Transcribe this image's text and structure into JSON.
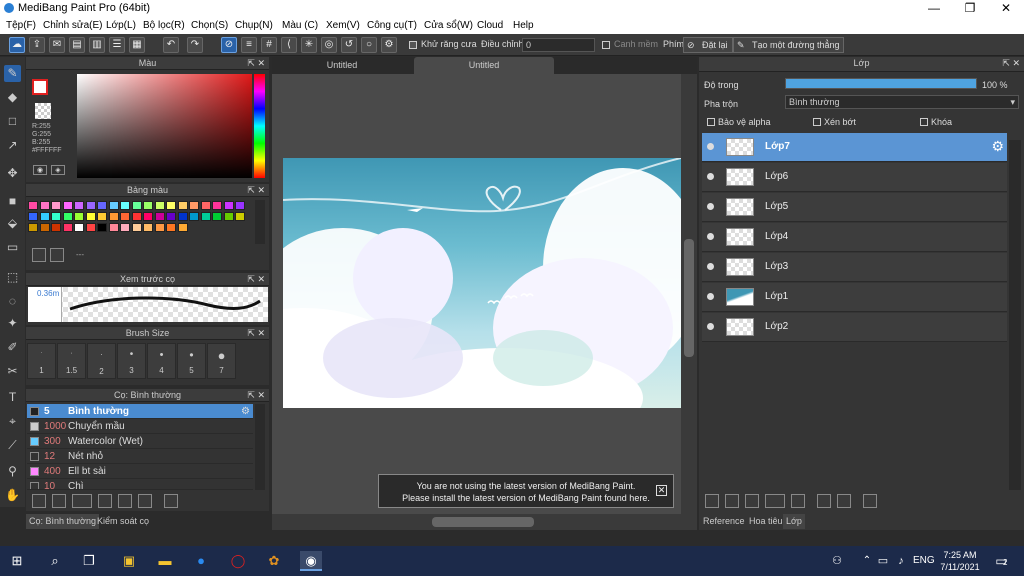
{
  "titlebar": {
    "title": "MediBang Paint Pro (64bit)",
    "minimize": "—",
    "maximize": "❐",
    "close": "✕"
  },
  "menu": [
    "Tệp(F)",
    "Chỉnh sửa(E)",
    "Lớp(L)",
    "Bộ lọc(R)",
    "Chọn(S)",
    "Chụp(N)",
    "Màu (C)",
    "Xem(V)",
    "Công cụ(T)",
    "Cửa sổ(W)",
    "Cloud",
    "Help"
  ],
  "toolbar": {
    "antialias_label": "Khử răng cưa",
    "correction_label": "Điều chỉnh",
    "correction_value": "0",
    "snap_label": "Canh mềm",
    "shortcut_label": "Phím",
    "reset_label": "Đặt lại",
    "straight_line_label": "Tạo một đường thẳng"
  },
  "color_panel": {
    "title": "Màu",
    "r": "R:255",
    "g": "G:255",
    "b": "B:255",
    "hex": "#FFFFFF"
  },
  "palette_panel": {
    "title": "Bảng màu",
    "dash": "---",
    "swatches": [
      "#ff4aa3",
      "#ff73c6",
      "#ff99cc",
      "#ff66ff",
      "#cc66ff",
      "#9966ff",
      "#6666ff",
      "#66ccff",
      "#66ffff",
      "#66ff99",
      "#99ff66",
      "#ccff66",
      "#ffff66",
      "#ffcc66",
      "#ff9966",
      "#ff6666",
      "#ff3399",
      "#cc33ff",
      "#9933ff",
      "#3366ff",
      "#33ccff",
      "#33ffcc",
      "#33ff66",
      "#99ff33",
      "#ffff33",
      "#ffcc33",
      "#ff9933",
      "#ff6633",
      "#ff3333",
      "#ff0066",
      "#cc0099",
      "#6600cc",
      "#0033cc",
      "#0099cc",
      "#00cc99",
      "#00cc33",
      "#66cc00",
      "#cccc00",
      "#cc9900",
      "#cc6600",
      "#cc3300",
      "#ff3366",
      "#ffffff",
      "#ff4444",
      "#000000",
      "#ff8899",
      "#ffaabb",
      "#ffcc99",
      "#ffbb66",
      "#ff9944",
      "#ff7722",
      "#ffaa33"
    ]
  },
  "preview_panel": {
    "title": "Xem trước cọ",
    "size": "0.36m"
  },
  "brushsize_panel": {
    "title": "Brush Size",
    "sizes": [
      "1",
      "1.5",
      "2",
      "3",
      "4",
      "5",
      "7"
    ]
  },
  "brush_panel": {
    "title": "Cọ: Bình thường",
    "brushes": [
      {
        "size": "5",
        "name": "Bình thường",
        "color": "#222222"
      },
      {
        "size": "1000",
        "name": "Chuyển mầu",
        "color": "#cccccc"
      },
      {
        "size": "300",
        "name": "Watercolor (Wet)",
        "color": "#66ccff"
      },
      {
        "size": "12",
        "name": "Nét nhỏ",
        "color": "#333333"
      },
      {
        "size": "400",
        "name": "Ell bt sài",
        "color": "#ff88ff"
      },
      {
        "size": "10",
        "name": "Chì",
        "color": "#333333"
      }
    ]
  },
  "left_bottom_tabs": [
    "Cọ: Bình thường",
    "Kiểm soát cọ"
  ],
  "doc_tabs": [
    "Untitled",
    "Untitled"
  ],
  "notification": {
    "line1": "You are not using the latest version of MediBang Paint.",
    "line2": "Please install the latest version of MediBang Paint found here.",
    "close": "✕"
  },
  "layer_panel": {
    "title": "Lớp",
    "opacity_label": "Độ trong",
    "opacity_value": "100 %",
    "opacity_fraction": 1.0,
    "blend_label": "Pha trộn",
    "blend_value": "Bình thường",
    "protect_alpha": "Bảo vệ alpha",
    "clipping": "Xén bớt",
    "lock": "Khóa",
    "layers": [
      "Lớp7",
      "Lớp6",
      "Lớp5",
      "Lớp4",
      "Lớp3",
      "Lớp1",
      "Lớp2"
    ]
  },
  "right_bottom_tabs": [
    "Reference",
    "Hoa tiêu",
    "Lớp"
  ],
  "taskbar": {
    "lang": "ENG",
    "time": "7:25 AM",
    "date": "7/11/2021",
    "notif_count": "2"
  }
}
